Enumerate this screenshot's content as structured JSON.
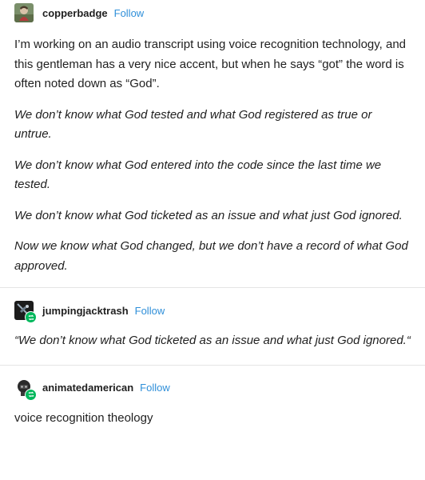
{
  "posts": [
    {
      "username": "copperbadge",
      "follow_label": "Follow",
      "paragraphs": [
        "I’m working on an audio transcript using voice recognition technology, and this gentleman has a very nice accent, but when he says “got” the word is often noted down as “God”.",
        "We don’t know what God tested and what God registered as true or untrue.",
        "We don’t know what God entered into the code since the last time we tested.",
        "We don’t know what God ticketed as an issue and what just God ignored.",
        "Now we know what God changed, but we don’t have a record of what God approved."
      ]
    },
    {
      "username": "jumpingjacktrash",
      "follow_label": "Follow",
      "paragraphs": [
        "“We don’t know what God ticketed as an issue and what just God ignored.“"
      ]
    },
    {
      "username": "animatedamerican",
      "follow_label": "Follow",
      "paragraphs": [
        "voice recognition theology"
      ]
    }
  ],
  "colors": {
    "follow": "#2f8fd9",
    "reblog_badge": "#00b85c",
    "divider": "#e4e4e4"
  },
  "icons": [
    "avatar-copperbadge",
    "avatar-jumpingjacktrash",
    "avatar-animatedamerican",
    "reblog-icon"
  ]
}
